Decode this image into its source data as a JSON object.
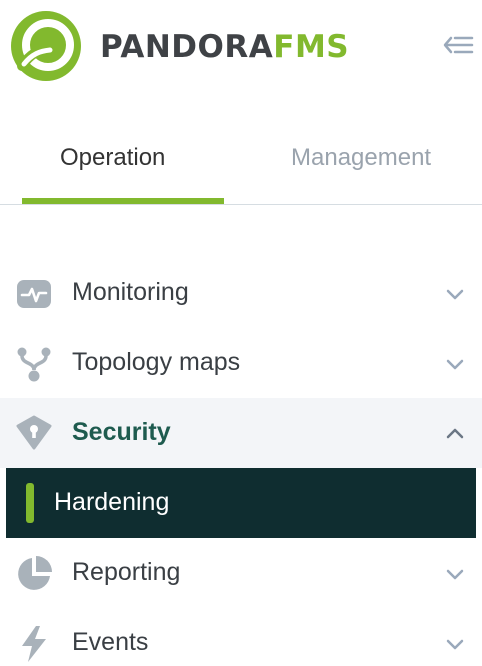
{
  "header": {
    "brand_main": "PANDORA",
    "brand_accent": "FMS"
  },
  "tabs": [
    {
      "label": "Operation",
      "active": true
    },
    {
      "label": "Management",
      "active": false
    }
  ],
  "menu": {
    "items": [
      {
        "label": "Monitoring",
        "icon": "monitoring-icon",
        "expanded": false
      },
      {
        "label": "Topology maps",
        "icon": "topology-icon",
        "expanded": false
      },
      {
        "label": "Security",
        "icon": "shield-icon",
        "expanded": true,
        "children": [
          {
            "label": "Hardening",
            "active": true
          }
        ]
      },
      {
        "label": "Reporting",
        "icon": "pie-chart-icon",
        "expanded": false
      },
      {
        "label": "Events",
        "icon": "lightning-icon",
        "expanded": false
      }
    ]
  },
  "colors": {
    "brand_green": "#82b92e",
    "brand_dark": "#3f4246",
    "active_submenu_bg": "#0f2d30",
    "active_parent_text": "#1e5b4f",
    "inactive_tab_text": "#9aa3ad",
    "icon_gray": "#a9b2ba"
  }
}
